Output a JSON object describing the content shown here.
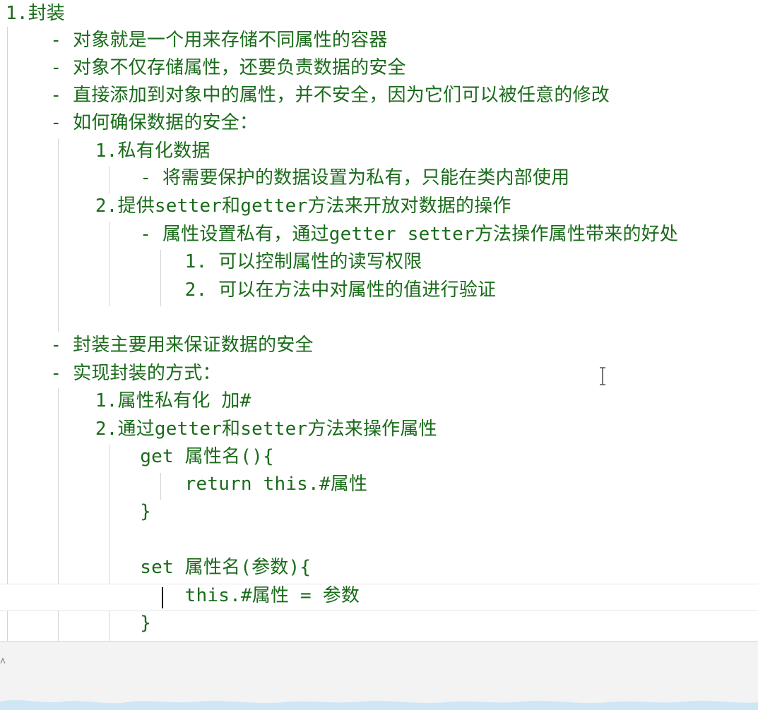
{
  "document": {
    "lines": [
      "1.封装",
      "    - 对象就是一个用来存储不同属性的容器",
      "    - 对象不仅存储属性，还要负责数据的安全",
      "    - 直接添加到对象中的属性，并不安全，因为它们可以被任意的修改",
      "    - 如何确保数据的安全：",
      "        1.私有化数据",
      "            - 将需要保护的数据设置为私有，只能在类内部使用",
      "        2.提供setter和getter方法来开放对数据的操作",
      "            - 属性设置私有，通过getter setter方法操作属性带来的好处",
      "                1. 可以控制属性的读写权限",
      "                2. 可以在方法中对属性的值进行验证",
      "",
      "    - 封装主要用来保证数据的安全",
      "    - 实现封装的方式：",
      "        1.属性私有化 加#",
      "        2.通过getter和setter方法来操作属性",
      "            get 属性名(){",
      "                return this.#属性",
      "            }",
      "",
      "            set 属性名(参数){",
      "                this.#属性 = 参数",
      "            }"
    ]
  },
  "colors": {
    "text": "#1a6b1a",
    "guide": "#d4d4d4",
    "footer_bg": "#f3f3f3",
    "wave": "#cfe6f5"
  },
  "icons": {
    "cursor": "i-beam-cursor-icon",
    "caret": "text-caret"
  }
}
